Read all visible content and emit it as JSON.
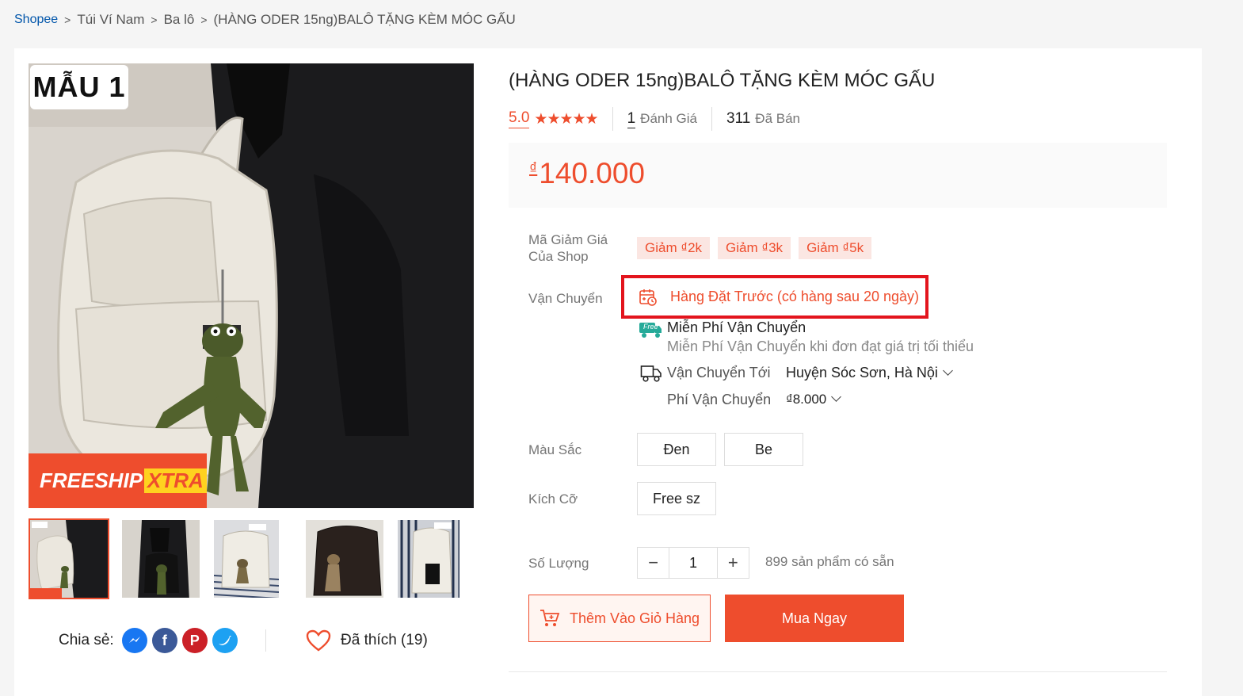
{
  "breadcrumb": {
    "items": [
      "Shopee",
      "Túi Ví Nam",
      "Ba lô",
      "(HÀNG ODER 15ng)BALÔ TẶNG KÈM MÓC GẤU"
    ]
  },
  "gallery": {
    "variant_label": "MẪU 1",
    "freeship_main": "FREESHIP",
    "freeship_xtra": "XTRA",
    "thumbnail_count": 5,
    "active_thumbnail": 0
  },
  "share": {
    "label": "Chia sẻ:",
    "icons": [
      "messenger-icon",
      "facebook-icon",
      "pinterest-icon",
      "twitter-icon"
    ]
  },
  "like": {
    "label": "Đã thích (19)"
  },
  "product": {
    "title": "(HÀNG ODER 15ng)BALÔ TẶNG KÈM MÓC GẤU",
    "rating": "5.0",
    "stars": "★★★★★",
    "reviews_count": "1",
    "reviews_label": "Đánh Giá",
    "sold_count": "311",
    "sold_label": "Đã Bán",
    "currency": "₫",
    "price": "140.000"
  },
  "vouchers": {
    "label": "Mã Giảm Giá Của Shop",
    "label_line1": "Mã Giảm Giá",
    "label_line2": "Của Shop",
    "items": [
      "Giảm ₫2k",
      "Giảm ₫3k",
      "Giảm ₫5k"
    ]
  },
  "shipping": {
    "label": "Vận Chuyển",
    "preorder": "Hàng Đặt Trước (có hàng sau 20 ngày)",
    "free_title": "Miễn Phí Vận Chuyển",
    "free_desc": "Miễn Phí Vận Chuyển khi đơn đạt giá trị tối thiểu",
    "free_badge": "Free",
    "to_label": "Vận Chuyển Tới",
    "to_value": "Huyện Sóc Sơn, Hà Nội",
    "fee_label": "Phí Vận Chuyển",
    "fee_value": "₫8.000"
  },
  "options": {
    "color_label": "Màu Sắc",
    "colors": [
      "Đen",
      "Be"
    ],
    "size_label": "Kích Cỡ",
    "sizes": [
      "Free sz"
    ]
  },
  "quantity": {
    "label": "Số Lượng",
    "value": "1",
    "minus": "−",
    "plus": "+",
    "stock": "899 sản phẩm có sẵn"
  },
  "actions": {
    "add_to_cart": "Thêm Vào Giỏ Hàng",
    "buy_now": "Mua Ngay"
  },
  "colors": {
    "accent": "#ee4d2d",
    "highlight_border": "#e3141d",
    "link": "#0055aa"
  }
}
